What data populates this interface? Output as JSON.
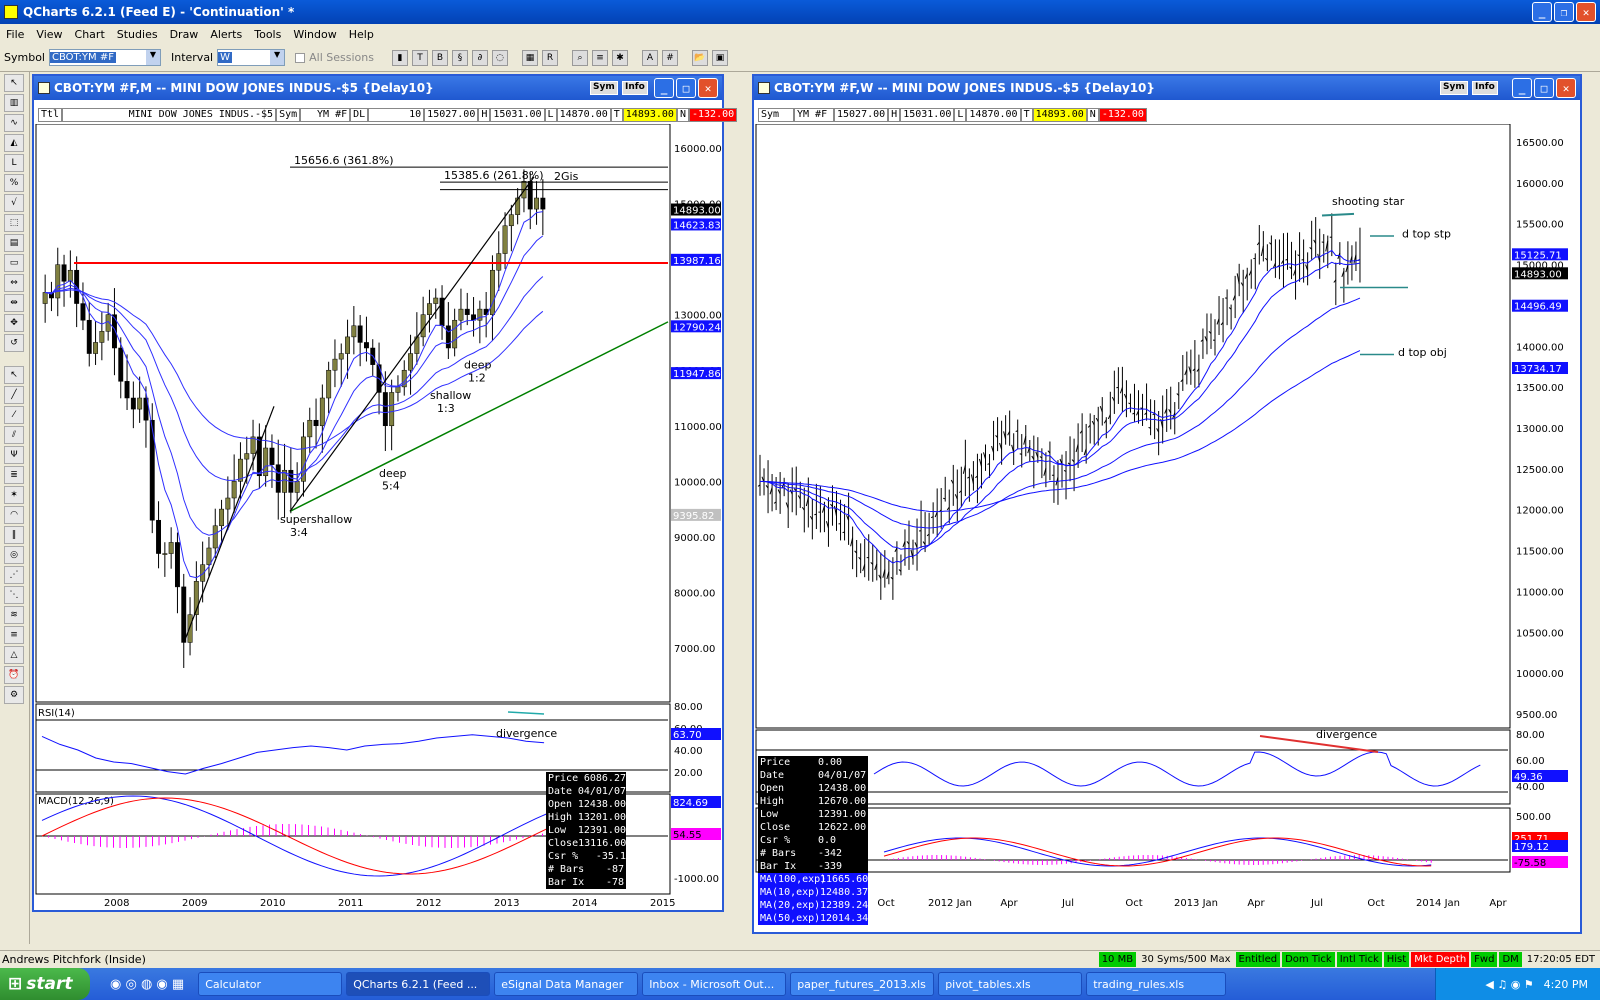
{
  "app": {
    "title": "QCharts 6.2.1 (Feed E) - 'Continuation' *"
  },
  "menu": [
    "File",
    "View",
    "Chart",
    "Studies",
    "Draw",
    "Alerts",
    "Tools",
    "Window",
    "Help"
  ],
  "toolbar": {
    "symbol_label": "Symbol",
    "symbol_value": "CBOT:YM #F",
    "interval_label": "Interval",
    "interval_value": "W",
    "all_sessions": "All Sessions"
  },
  "left": {
    "title": "CBOT:YM #F,M -- MINI DOW JONES INDUS.-$5 {Delay10}",
    "sym": "Sym",
    "inf": "Info",
    "quote": [
      "Ttl",
      "MINI DOW JONES INDUS.-$5",
      "Sym",
      "YM #F",
      "DL",
      "10",
      "15027.00",
      "H",
      "15031.00",
      "L",
      "14870.00",
      "T",
      "14893.00",
      "N",
      "-132.00"
    ],
    "yticks": [
      "16000.00",
      "15000.00",
      "14000.00",
      "13000.00",
      "12000.00",
      "11000.00",
      "10000.00",
      "9000.00",
      "8000.00",
      "7000.00"
    ],
    "price_tags": [
      {
        "t": "14893.00",
        "c": "#000000"
      },
      {
        "t": "14623.83",
        "c": "#1010ff"
      },
      {
        "t": "13987.16",
        "c": "#1010ff"
      },
      {
        "t": "12790.24",
        "c": "#1010ff"
      },
      {
        "t": "11947.86",
        "c": "#1010ff"
      },
      {
        "t": "9395.82",
        "c": "#c0c0c0"
      }
    ],
    "xticks": [
      "2008",
      "2009",
      "2010",
      "2011",
      "2012",
      "2013",
      "2014",
      "2015"
    ],
    "annotations": [
      "15656.6 (361.8%)",
      "15385.6 (261.8%)",
      "2Gis",
      "supershallow",
      "3:4",
      "deep",
      "5:4",
      "shallow",
      "1:3",
      "deep",
      "1:2"
    ],
    "rsi": {
      "label": "RSI(14)",
      "ticks": [
        "80.00",
        "60.00",
        "40.00",
        "20.00"
      ],
      "value": "63.70",
      "note": "divergence"
    },
    "macd": {
      "label": "MACD(12,26,9)",
      "value": "824.69",
      "hist": "54.55",
      "tick": "-1000.00"
    },
    "info": [
      [
        "Price",
        "6086.27"
      ],
      [
        "Date",
        "04/01/07"
      ],
      [
        "Open",
        "12438.00"
      ],
      [
        "High",
        "13201.00"
      ],
      [
        "Low",
        "12391.00"
      ],
      [
        "Close",
        "13116.00"
      ],
      [
        "Csr %",
        "-35.1"
      ],
      [
        "# Bars",
        "-87"
      ],
      [
        "Bar Ix",
        "-78"
      ]
    ]
  },
  "right": {
    "title": "CBOT:YM #F,W -- MINI DOW JONES INDUS.-$5 {Delay10}",
    "sym": "Sym",
    "inf": "Info",
    "quote": [
      "Sym",
      "YM #F",
      "15027.00",
      "H",
      "15031.00",
      "L",
      "14870.00",
      "T",
      "14893.00",
      "N",
      "-132.00"
    ],
    "yticks": [
      "16500.00",
      "16000.00",
      "15500.00",
      "15000.00",
      "14500.00",
      "14000.00",
      "13500.00",
      "13000.00",
      "12500.00",
      "12000.00",
      "11500.00",
      "11000.00",
      "10500.00",
      "10000.00",
      "9500.00"
    ],
    "price_tags": [
      {
        "t": "15125.71",
        "c": "#1010ff"
      },
      {
        "t": "14893.00",
        "c": "#000000"
      },
      {
        "t": "14496.49",
        "c": "#1010ff"
      },
      {
        "t": "13734.17",
        "c": "#1010ff"
      }
    ],
    "xticks": [
      "Oct",
      "2012 Jan",
      "Apr",
      "Jul",
      "Oct",
      "2013 Jan",
      "Apr",
      "Jul",
      "Oct",
      "2014 Jan",
      "Apr"
    ],
    "annotations": [
      "shooting star",
      "d top stp",
      "d top obj"
    ],
    "rsi": {
      "ticks": [
        "80.00",
        "60.00",
        "40.00"
      ],
      "value": "49.36",
      "note": "divergence"
    },
    "macd": {
      "tick": "500.00",
      "v1": "179.12",
      "v2": "-75.58",
      "v3": "251.71"
    },
    "info": [
      [
        "Price",
        "0.00"
      ],
      [
        "Date",
        "04/01/07"
      ],
      [
        "Open",
        "12438.00"
      ],
      [
        "High",
        "12670.00"
      ],
      [
        "Low",
        "12391.00"
      ],
      [
        "Close",
        "12622.00"
      ],
      [
        "Csr %",
        "0.0"
      ],
      [
        "# Bars",
        "-342"
      ],
      [
        "Bar Ix",
        "-339"
      ]
    ],
    "info_ma": [
      [
        "MA(100,exp)",
        "11665.60"
      ],
      [
        "MA(10,exp)",
        "12480.37"
      ],
      [
        "MA(20,exp)",
        "12389.24"
      ],
      [
        "MA(50,exp)",
        "12014.34"
      ]
    ]
  },
  "status": {
    "left": "Andrews Pitchfork (Inside)",
    "items": [
      "10 MB",
      "30 Syms/500 Max",
      "Entitled",
      "Dom Tick",
      "Intl Tick",
      "Hist",
      "Mkt Depth",
      "Fwd",
      "DM",
      "17:20:05 EDT"
    ]
  },
  "taskbar": {
    "start": "start",
    "tasks": [
      "Calculator",
      "QCharts 6.2.1 (Feed ...",
      "eSignal Data Manager",
      "Inbox - Microsoft Out...",
      "paper_futures_2013.xls",
      "pivot_tables.xls",
      "trading_rules.xls"
    ],
    "clock": "4:20 PM"
  },
  "colors": {
    "title_blue": "#0a5bd9",
    "ma_blue": "#1010ff",
    "red_line": "#ff0000",
    "green_line": "#008000"
  }
}
